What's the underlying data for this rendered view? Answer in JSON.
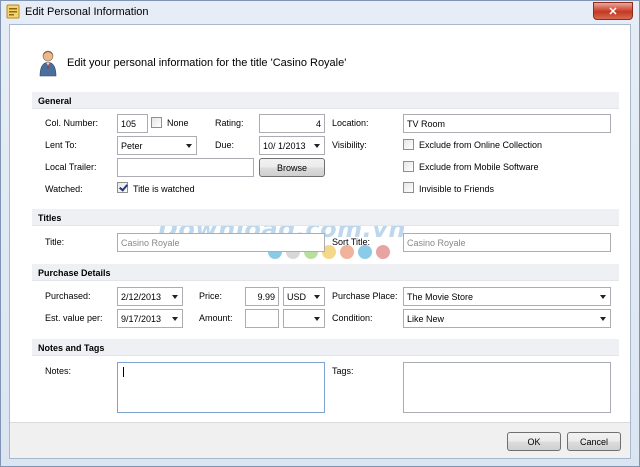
{
  "window": {
    "title": "Edit Personal Information",
    "close_glyph": "✕"
  },
  "header": {
    "text": "Edit your personal information for the title 'Casino Royale'"
  },
  "general": {
    "section_title": "General",
    "col_number_label": "Col. Number:",
    "col_number_value": "105",
    "none_label": "None",
    "rating_label": "Rating:",
    "rating_value": "4",
    "location_label": "Location:",
    "location_value": "TV Room",
    "lent_to_label": "Lent To:",
    "lent_to_value": "Peter",
    "due_label": "Due:",
    "due_value": "10/  1/2013",
    "visibility_label": "Visibility:",
    "exclude_online_label": "Exclude from Online Collection",
    "local_trailer_label": "Local Trailer:",
    "local_trailer_value": "",
    "browse_label": "Browse",
    "exclude_mobile_label": "Exclude from Mobile Software",
    "watched_label": "Watched:",
    "title_watched_label": "Title is watched",
    "invisible_friends_label": "Invisible to Friends"
  },
  "titles": {
    "section_title": "Titles",
    "title_label": "Title:",
    "title_value": "Casino Royale",
    "sort_title_label": "Sort Title:",
    "sort_title_value": "Casino Royale"
  },
  "purchase": {
    "section_title": "Purchase Details",
    "purchased_label": "Purchased:",
    "purchased_value": "2/12/2013",
    "price_label": "Price:",
    "price_value": "9.99",
    "currency_value": "USD",
    "place_label": "Purchase Place:",
    "place_value": "The Movie Store",
    "est_value_label": "Est. value per:",
    "est_value_date": "9/17/2013",
    "amount_label": "Amount:",
    "amount_value": "",
    "amount_select": "",
    "condition_label": "Condition:",
    "condition_value": "Like New"
  },
  "notes": {
    "section_title": "Notes and Tags",
    "notes_label": "Notes:",
    "tags_label": "Tags:"
  },
  "footer": {
    "ok_label": "OK",
    "cancel_label": "Cancel"
  },
  "watermark": {
    "text": "Download.com.vn",
    "dot_colors": [
      "#8ccbe8",
      "#d8d8d8",
      "#b9dfa0",
      "#f5d78a",
      "#f1b39b",
      "#8ccbe8",
      "#e8a3a3"
    ]
  },
  "colors": {
    "section_bg": "#eef0f4",
    "window_frame": "#dbe5f1",
    "close_red": "#c23a24"
  }
}
